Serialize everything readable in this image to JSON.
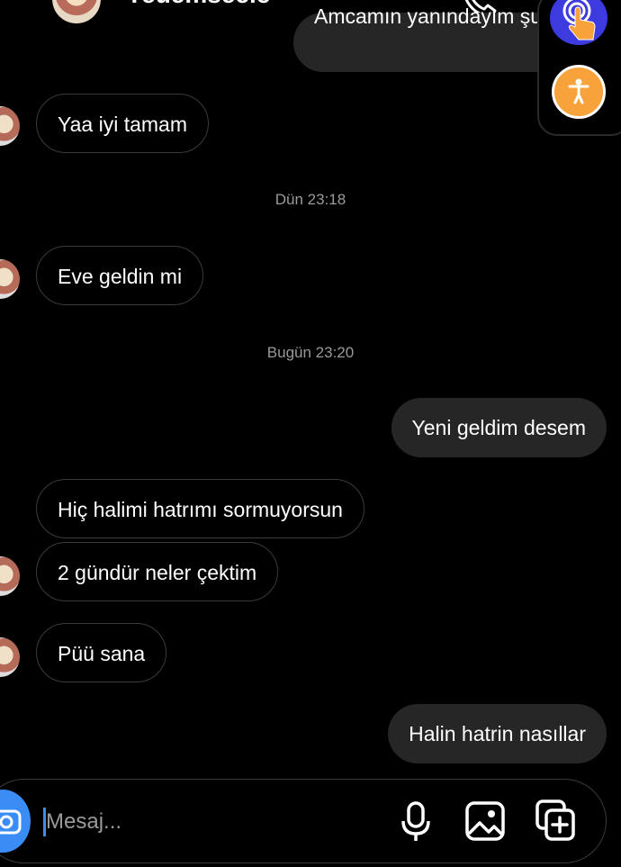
{
  "header": {
    "contact_name": "Yeuemsecic"
  },
  "messages": [
    {
      "from": "me",
      "text": "Amcamın yanındayım şu an"
    },
    {
      "from": "them",
      "text": "Yaa iyi tamam"
    },
    {
      "timestamp": "Dün 23:18"
    },
    {
      "from": "them",
      "text": "Eve geldin mi"
    },
    {
      "timestamp": "Bugün 23:20"
    },
    {
      "from": "me",
      "text": "Yeni geldim desem"
    },
    {
      "from": "them",
      "text": "Hiç halimi hatrımı sormuyorsun"
    },
    {
      "from": "them",
      "text": "2 gündür neler çektim"
    },
    {
      "from": "them",
      "text": "Püü sana"
    },
    {
      "from": "me",
      "text": "Halin hatrin nasıllar"
    }
  ],
  "composer": {
    "placeholder": "Mesaj..."
  },
  "icons": {
    "phone": "phone-icon",
    "camera": "camera-icon",
    "mic": "microphone-icon",
    "gallery": "image-icon",
    "sticker": "sticker-add-icon",
    "touch": "touch-assist-icon",
    "accessibility": "accessibility-icon"
  },
  "colors": {
    "background": "#000000",
    "incoming_border": "#3a3a3a",
    "outgoing_bubble": "#262626",
    "accent": "#3a8df5",
    "touch_button": "#3d3ae0",
    "accessibility_button": "#f7a23a"
  }
}
